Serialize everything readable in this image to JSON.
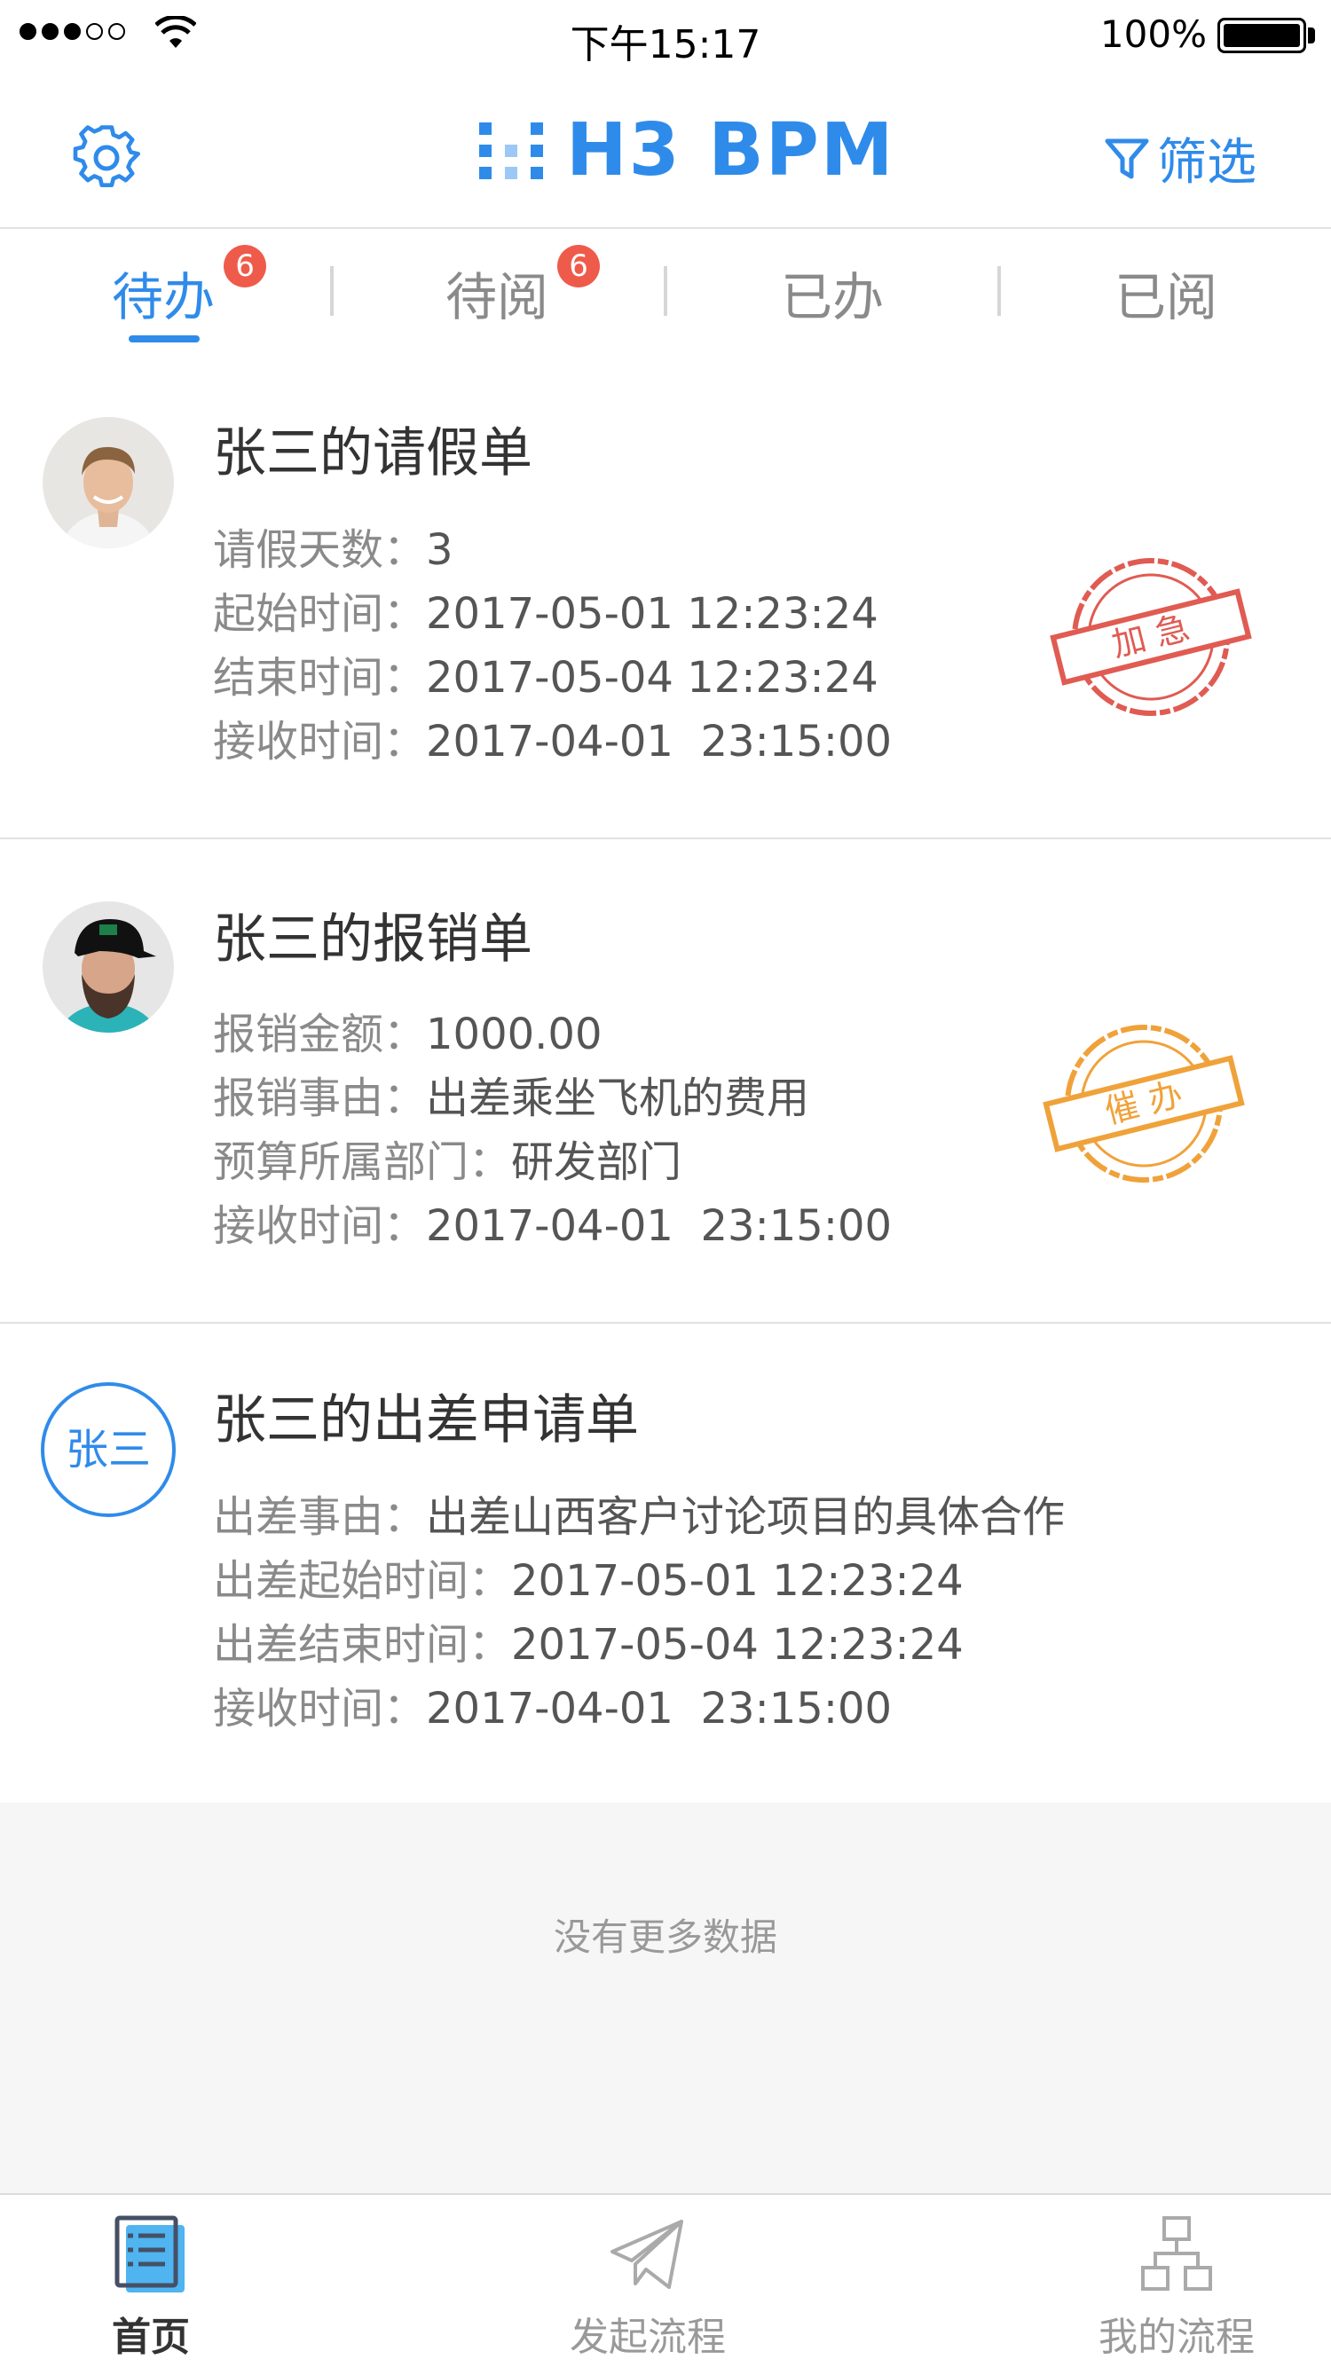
{
  "status_bar": {
    "time": "下午15:17",
    "battery": "100%"
  },
  "header": {
    "logo_text": "H3 BPM",
    "filter_label": "筛选"
  },
  "tabs": [
    {
      "label": "待办",
      "badge": "6"
    },
    {
      "label": "待阅",
      "badge": "6"
    },
    {
      "label": "已办"
    },
    {
      "label": "已阅"
    }
  ],
  "cards": [
    {
      "title": "张三的请假单",
      "fields": [
        {
          "label": "请假天数：",
          "value": "3"
        },
        {
          "label": "起始时间：",
          "value": "2017-05-01 12:23:24"
        },
        {
          "label": "结束时间：",
          "value": "2017-05-04 12:23:24"
        },
        {
          "label": "接收时间：",
          "value": "2017-04-01  23:15:00"
        }
      ],
      "stamp": "加 急",
      "stamp_color": "#e05b52"
    },
    {
      "title": "张三的报销单",
      "fields": [
        {
          "label": "报销金额：",
          "value": "1000.00"
        },
        {
          "label": "报销事由：",
          "value": "出差乘坐飞机的费用"
        },
        {
          "label": "预算所属部门：",
          "value": "研发部门"
        },
        {
          "label": "接收时间：",
          "value": "2017-04-01  23:15:00"
        }
      ],
      "stamp": "催 办",
      "stamp_color": "#f0a23a"
    },
    {
      "title": "张三的出差申请单",
      "avatar_text": "张三",
      "fields": [
        {
          "label": "出差事由：",
          "value": "出差山西客户讨论项目的具体合作"
        },
        {
          "label": "出差起始时间：",
          "value": "2017-05-01 12:23:24"
        },
        {
          "label": "出差结束时间：",
          "value": "2017-05-04 12:23:24"
        },
        {
          "label": "接收时间：",
          "value": "2017-04-01  23:15:00"
        }
      ]
    }
  ],
  "footer_text": "没有更多数据",
  "tabbar": [
    {
      "label": "首页",
      "icon": "list-doc-icon"
    },
    {
      "label": "发起流程",
      "icon": "paper-plane-icon"
    },
    {
      "label": "我的流程",
      "icon": "org-chart-icon"
    }
  ],
  "colors": {
    "accent": "#2f8bea",
    "badge": "#ef5b4a",
    "urgent": "#e05b52",
    "reminder": "#f0a23a"
  }
}
